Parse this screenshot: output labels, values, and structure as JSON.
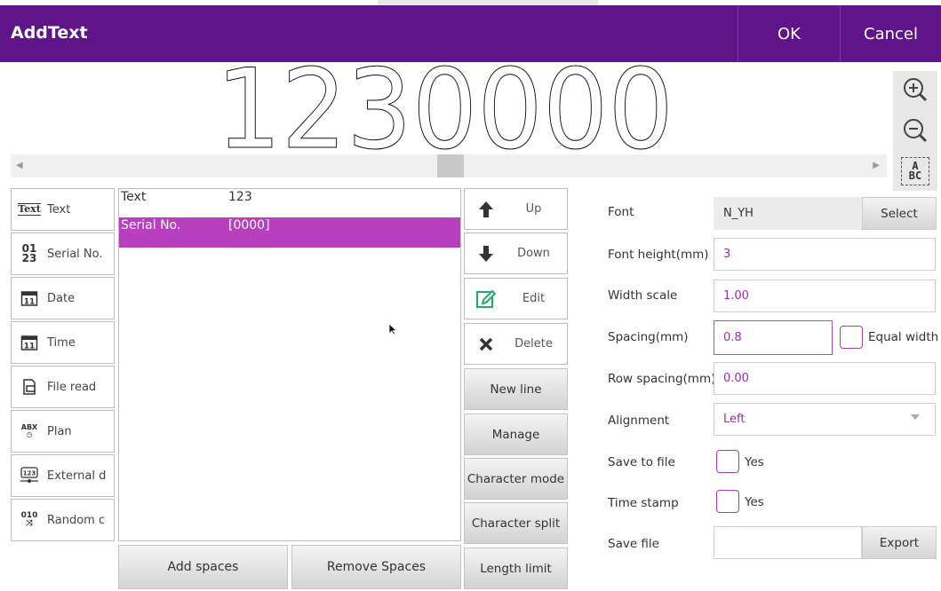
{
  "window": {
    "title": "AddText",
    "ok_label": "OK",
    "cancel_label": "Cancel"
  },
  "preview": {
    "text": "1230000"
  },
  "types": [
    {
      "icon": "text-icon",
      "label": "Text"
    },
    {
      "icon": "serial-number-icon",
      "label": "Serial No."
    },
    {
      "icon": "date-calendar-icon",
      "label": "Date"
    },
    {
      "icon": "time-calendar-icon",
      "label": "Time"
    },
    {
      "icon": "file-read-icon",
      "label": "File read"
    },
    {
      "icon": "plan-icon",
      "label": "Plan"
    },
    {
      "icon": "external-data-icon",
      "label": "External d"
    },
    {
      "icon": "random-icon",
      "label": "Random c"
    }
  ],
  "elements": [
    {
      "type": "Text",
      "value": "123",
      "selected": false
    },
    {
      "type": "Serial No.",
      "value": "[0000]",
      "selected": true
    }
  ],
  "bottom_buttons": {
    "add_spaces": "Add spaces",
    "remove_spaces": "Remove Spaces"
  },
  "actions": {
    "up": "Up",
    "down": "Down",
    "edit": "Edit",
    "delete": "Delete"
  },
  "action_buttons": {
    "new_line": "New line",
    "manage": "Manage",
    "character_mode": "Character mode",
    "character_split": "Character split",
    "length_limit": "Length limit"
  },
  "properties": {
    "font_label": "Font",
    "font_value": "N_YH",
    "font_select": "Select",
    "font_height_label": "Font height(mm)",
    "font_height_value": "3",
    "width_scale_label": "Width scale",
    "width_scale_value": "1.00",
    "spacing_label": "Spacing(mm)",
    "spacing_value": "0.8",
    "equal_width_label": "Equal width",
    "row_spacing_label": "Row spacing(mm)",
    "row_spacing_value": "0.00",
    "alignment_label": "Alignment",
    "alignment_value": "Left",
    "save_to_file_label": "Save to file",
    "save_to_file_yes": "Yes",
    "time_stamp_label": "Time stamp",
    "time_stamp_yes": "Yes",
    "save_file_label": "Save file",
    "save_file_value": "",
    "export_label": "Export"
  },
  "colors": {
    "header": "#5f1488",
    "selection": "#b83fbe",
    "accent_text": "#9c2bb0",
    "edit_icon": "#27a86a"
  }
}
